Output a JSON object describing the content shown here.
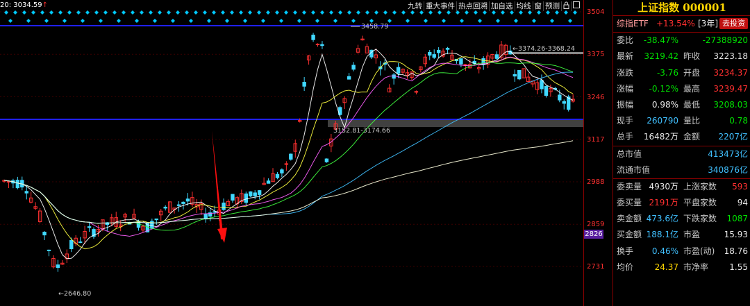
{
  "toolbar": {
    "items": [
      "九转",
      "重大事件",
      "热点回溯",
      "加自选",
      "均线",
      "窗",
      "预测"
    ],
    "lock_icon": "lock-icon",
    "expand_icon": "expand-icon"
  },
  "ma_readout": {
    "label": "20: 3034.59",
    "arrow": "↑"
  },
  "y_axis": {
    "ticks": [
      "3504",
      "3375",
      "3246",
      "3117",
      "2988",
      "2859",
      "2731"
    ]
  },
  "price_tag": "2826",
  "annotations": {
    "high": "3458.79",
    "low": "2646.80",
    "band_top": "3374.26-3368.24",
    "band_bottom": "3152.81-3174.66"
  },
  "colors": {
    "up": "#ff3030",
    "down": "#40d8ff",
    "line_blue": "#2020ff",
    "accent": "#ffd700"
  },
  "panel": {
    "title": "上证指数 000001",
    "etf": {
      "label": "综指ETF",
      "change": "+13.54%",
      "period": "[3年]",
      "button": "去投资"
    },
    "rows": [
      {
        "l1": "委比",
        "v1": "-38.47%",
        "c1": "green",
        "l2": "",
        "v2": "-27388920",
        "c2": "green"
      },
      {
        "l1": "最新",
        "v1": "3219.42",
        "c1": "green",
        "l2": "昨收",
        "v2": "3223.18",
        "c2": "white"
      },
      {
        "l1": "涨跌",
        "v1": "-3.76",
        "c1": "green",
        "l2": "开盘",
        "v2": "3234.37",
        "c2": "red"
      },
      {
        "l1": "涨幅",
        "v1": "-0.12%",
        "c1": "green",
        "l2": "最高",
        "v2": "3239.47",
        "c2": "red"
      },
      {
        "l1": "振幅",
        "v1": "0.98%",
        "c1": "white",
        "l2": "最低",
        "v2": "3208.03",
        "c2": "green"
      },
      {
        "l1": "现手",
        "v1": "260790",
        "c1": "cyan",
        "l2": "量比",
        "v2": "0.78",
        "c2": "green"
      },
      {
        "l1": "总手",
        "v1": "16482万",
        "c1": "white",
        "l2": "金额",
        "v2": "2207亿",
        "c2": "cyan"
      }
    ],
    "caps": [
      {
        "l1": "总市值",
        "v2": "413473亿"
      },
      {
        "l1": "流通市值",
        "v2": "340876亿"
      }
    ],
    "stats": [
      {
        "l1": "委卖量",
        "v1": "4930万",
        "c1": "white",
        "l2": "上涨家数",
        "v2": "593",
        "c2": "red"
      },
      {
        "l1": "委买量",
        "v1": "2191万",
        "c1": "red",
        "l2": "平盘家数",
        "v2": "94",
        "c2": "white"
      },
      {
        "l1": "卖金额",
        "v1": "473.6亿",
        "c1": "cyan",
        "l2": "下跌家数",
        "v2": "1087",
        "c2": "green"
      },
      {
        "l1": "买金额",
        "v1": "188.1亿",
        "c1": "cyan",
        "l2": "市盈",
        "v2": "15.93",
        "c2": "white"
      },
      {
        "l1": "换手",
        "v1": "0.46%",
        "c1": "cyan",
        "l2": "市盈(动)",
        "v2": "18.76",
        "c2": "white"
      },
      {
        "l1": "均价",
        "v1": "24.37",
        "c1": "yellow",
        "l2": "市净率",
        "v2": "1.55",
        "c2": "white"
      }
    ]
  }
}
